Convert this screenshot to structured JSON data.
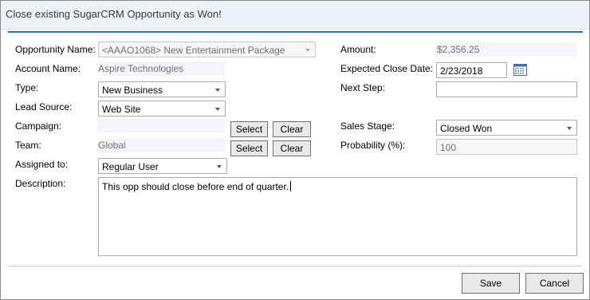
{
  "window": {
    "title": "Close existing SugarCRM Opportunity as Won!"
  },
  "left": {
    "opportunity_name": {
      "label": "Opportunity Name:",
      "value": "<AAAO1068> New Entertainment Package"
    },
    "account_name": {
      "label": "Account Name:",
      "value": "Aspire Technologies"
    },
    "type": {
      "label": "Type:",
      "value": "New Business"
    },
    "lead_source": {
      "label": "Lead Source:",
      "value": "Web Site"
    },
    "campaign": {
      "label": "Campaign:",
      "value": "",
      "select_label": "Select",
      "clear_label": "Clear"
    },
    "team": {
      "label": "Team:",
      "value": "Global",
      "select_label": "Select",
      "clear_label": "Clear"
    },
    "assigned_to": {
      "label": "Assigned to:",
      "value": "Regular User"
    }
  },
  "right": {
    "amount": {
      "label": "Amount:",
      "value": "$2,356.25"
    },
    "expected_close_date": {
      "label": "Expected Close Date:",
      "value": "2/23/2018"
    },
    "next_step": {
      "label": "Next Step:",
      "value": ""
    },
    "sales_stage": {
      "label": "Sales Stage:",
      "value": "Closed Won"
    },
    "probability": {
      "label": "Probability (%):",
      "value": "100"
    }
  },
  "description": {
    "label": "Description:",
    "value": "This opp should close before end of quarter."
  },
  "footer": {
    "save_label": "Save",
    "cancel_label": "Cancel"
  },
  "colors": {
    "accent": "#2d6fb7",
    "title_bg": "#eef1f7",
    "readonly_bg": "#f4f6fa"
  }
}
